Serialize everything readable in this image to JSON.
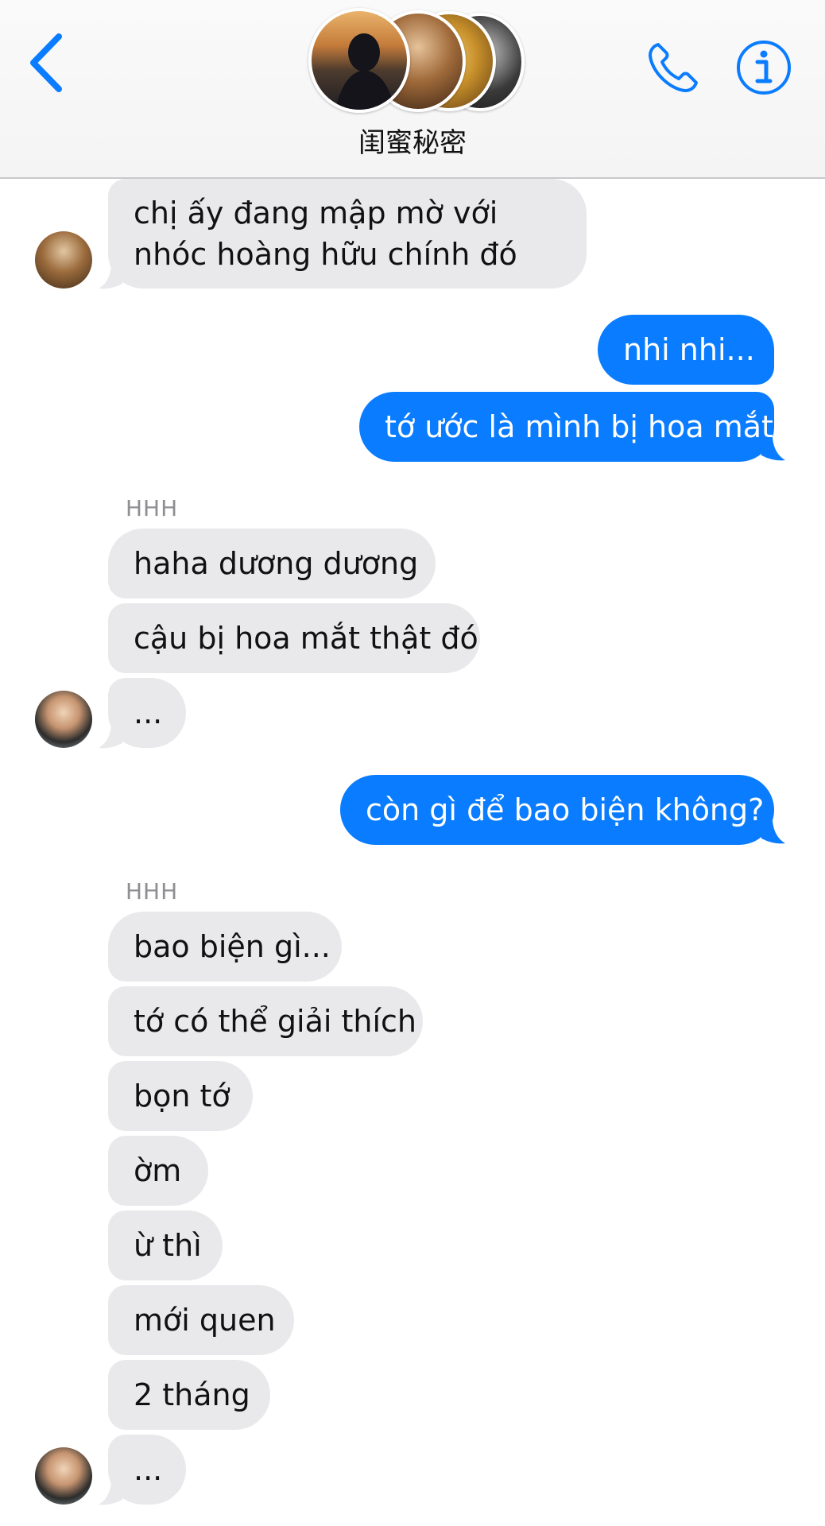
{
  "header": {
    "title": "闺蜜秘密",
    "back_icon": "chevron-left-icon",
    "call_icon": "phone-icon",
    "info_icon": "info-icon",
    "accent_color": "#0a7cff"
  },
  "messages": {
    "m1": {
      "sender": "other",
      "text": "chị ấy đang mập mờ với nhóc hoàng hữu chính đó"
    },
    "m2": {
      "sender": "me",
      "text": "nhi nhi..."
    },
    "m3": {
      "sender": "me",
      "text": "tớ ước là mình bị hoa mắt"
    },
    "name1": "HHH",
    "m4": {
      "sender": "other",
      "text": "haha dương dương"
    },
    "m5": {
      "sender": "other",
      "text": "cậu bị hoa mắt thật đó"
    },
    "m6": {
      "sender": "other",
      "text": "..."
    },
    "m7": {
      "sender": "me",
      "text": "còn gì để bao biện không?"
    },
    "name2": "HHH",
    "m8": {
      "sender": "other",
      "text": "bao biện gì..."
    },
    "m9": {
      "sender": "other",
      "text": "tớ có thể giải thích"
    },
    "m10": {
      "sender": "other",
      "text": "bọn tớ"
    },
    "m11": {
      "sender": "other",
      "text": "ờm"
    },
    "m12": {
      "sender": "other",
      "text": "ừ thì"
    },
    "m13": {
      "sender": "other",
      "text": "mới quen"
    },
    "m14": {
      "sender": "other",
      "text": "2 tháng"
    },
    "m15": {
      "sender": "other",
      "text": "..."
    }
  },
  "colors": {
    "incoming_bubble": "#e9e9eb",
    "outgoing_bubble": "#0a7cff",
    "sender_name": "#8e8e93"
  }
}
